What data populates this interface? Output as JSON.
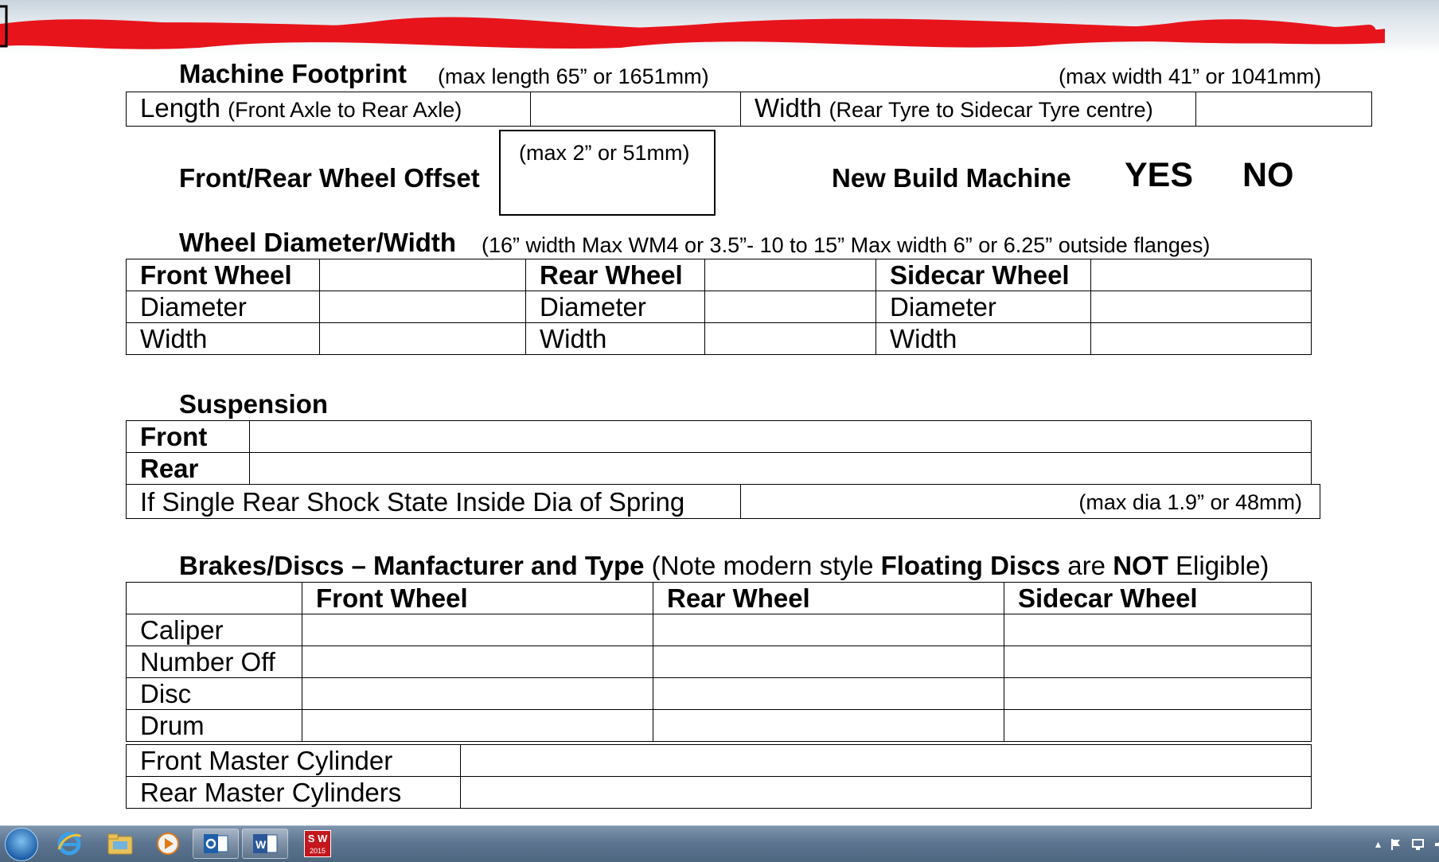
{
  "footprint": {
    "title": "Machine Footprint",
    "max_length_note": "(max length 65” or 1651mm)",
    "max_width_note": "(max width 41” or 1041mm)",
    "length_label": "Length",
    "length_sub": "(Front Axle to Rear Axle)",
    "width_label": "Width",
    "width_sub": "(Rear Tyre to Sidecar Tyre centre)"
  },
  "offset": {
    "label": "Front/Rear Wheel Offset",
    "max_note": "(max 2” or 51mm)"
  },
  "new_build": {
    "label": "New Build Machine",
    "yes": "YES",
    "no": "NO"
  },
  "wheel": {
    "title": "Wheel Diameter/Width",
    "note": "(16” width Max WM4 or 3.5”- 10 to 15” Max width 6” or 6.25” outside flanges)",
    "front_header": "Front Wheel",
    "rear_header": "Rear Wheel",
    "sidecar_header": "Sidecar Wheel",
    "diameter": "Diameter",
    "width": "Width"
  },
  "suspension": {
    "title": "Suspension",
    "front": "Front",
    "rear": "Rear",
    "single_shock": "If Single Rear Shock State Inside Dia of Spring",
    "max_dia_note": "(max dia 1.9” or 48mm)"
  },
  "brakes": {
    "title": "Brakes/Discs – Manfacturer and Type",
    "note_open": "(Note modern style ",
    "note_floating": "Floating Discs",
    "note_are": " are ",
    "note_not": "NOT",
    "note_close": " Eligible)",
    "front_header": "Front Wheel",
    "rear_header": "Rear Wheel",
    "sidecar_header": "Sidecar Wheel",
    "rows": [
      "Caliper",
      "Number Off",
      "Disc",
      "Drum"
    ],
    "front_master": "Front Master Cylinder",
    "rear_master": "Rear Master Cylinders"
  },
  "taskbar": {
    "solidworks_badge": "S W",
    "solidworks_year": "2015",
    "apps": [
      "start-orb-icon",
      "internet-explorer-icon",
      "file-explorer-icon",
      "media-player-icon",
      "outlook-icon",
      "word-icon",
      "solidworks-icon"
    ]
  },
  "colors": {
    "redaction": "#e8141c",
    "taskbar": "#5d7590"
  }
}
